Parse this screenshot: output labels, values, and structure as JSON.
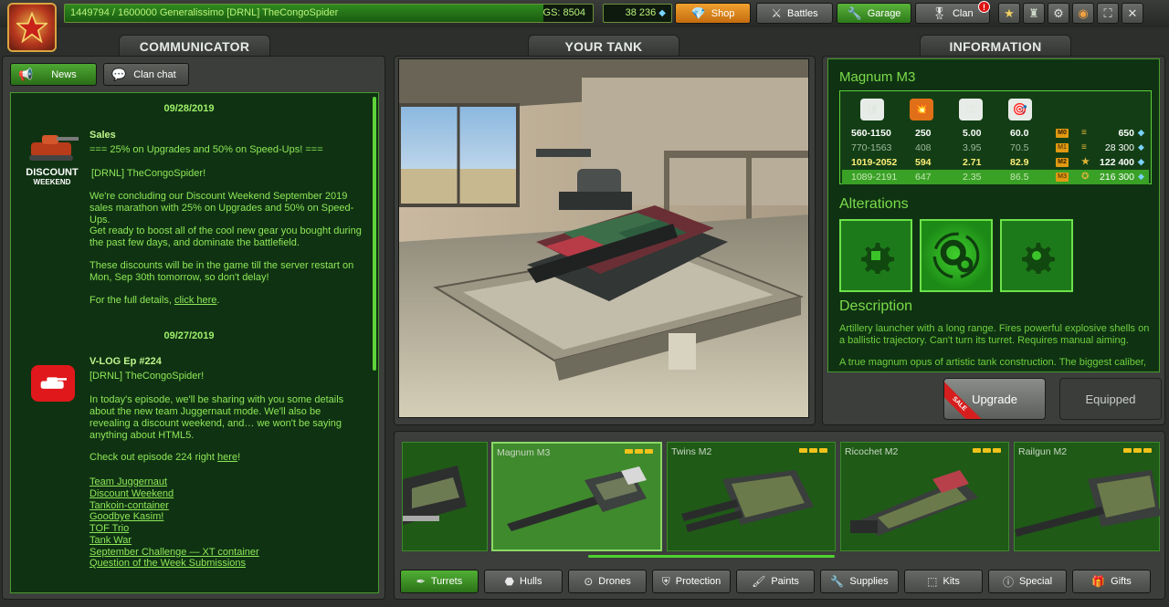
{
  "header": {
    "xp_text": "1449794 / 1600000  Generalissimo [DRNL] TheCongoSpider",
    "xp_progress": 0.906,
    "gs_text": "GS: 8504",
    "crystals": "38 236",
    "nav": [
      {
        "label": "Shop",
        "icon": "diamond-icon"
      },
      {
        "label": "Battles",
        "icon": "crossed-swords-icon"
      },
      {
        "label": "Garage",
        "icon": "wrench-icon"
      },
      {
        "label": "Clan",
        "icon": "medal-icon"
      }
    ],
    "clan_notification": "!",
    "icon_buttons": [
      "star-icon",
      "team-icon",
      "gear-icon",
      "sound-icon",
      "fullscreen-icon",
      "close-icon"
    ]
  },
  "communicator": {
    "tab_title": "COMMUNICATOR",
    "news_label": "News",
    "clanchat_label": "Clan chat",
    "posts": [
      {
        "date": "09/28/2019",
        "title": "Sales",
        "lines": [
          "=== 25% on Upgrades and 50% on Speed-Ups! ===",
          "[DRNL] TheCongoSpider!",
          "We're concluding our Discount Weekend September 2019 sales marathon with 25% on Upgrades and 50% on Speed-Ups.",
          "Get ready to boost all of the cool new gear you bought during the past few days, and dominate the battlefield.",
          "These discounts will be in the game till the server restart on Mon, Sep 30th tomorrow, so don't delay!",
          "For the full details, ",
          "click here",
          "."
        ],
        "badge_line1": "DISCOUNT",
        "badge_line2": "WEEKEND"
      },
      {
        "date": "09/27/2019",
        "title": "V-LOG Ep #224",
        "lines": [
          "[DRNL] TheCongoSpider!",
          "In today's episode, we'll be sharing with you some details about the new team Juggernaut mode. We'll also be revealing a discount weekend, and… we won't be saying anything about HTML5.",
          "Check out episode 224 right  ",
          "here",
          "!"
        ],
        "links": [
          "Team Juggernaut",
          "Discount Weekend",
          "Tankoin-container",
          "Goodbye Kasim!",
          "TOF Trio",
          "Tank War",
          "September Challenge — XT container",
          "Question of the Week Submissions"
        ]
      }
    ]
  },
  "tank": {
    "tab_title": "YOUR TANK"
  },
  "info": {
    "tab_title": "INFORMATION",
    "item_name": "Magnum M3",
    "stat_icons": [
      "damage-icon",
      "fire-icon",
      "reload-icon",
      "impact-icon"
    ],
    "rows": [
      {
        "v": [
          "560-1150",
          "250",
          "5.00",
          "60.0"
        ],
        "mk": "M0",
        "price": "650"
      },
      {
        "v": [
          "770-1563",
          "408",
          "3.95",
          "70.5"
        ],
        "mk": "M1",
        "price": "28 300"
      },
      {
        "v": [
          "1019-2052",
          "594",
          "2.71",
          "82.9"
        ],
        "mk": "M2",
        "price": "122 400"
      },
      {
        "v": [
          "1089-2191",
          "647",
          "2.35",
          "86.5"
        ],
        "mk": "M3",
        "price": "216 300"
      }
    ],
    "alterations_title": "Alterations",
    "description_title": "Description",
    "description_1": "Artillery launcher with a long range. Fires powerful explosive shells on a ballistic trajectory. Can't turn its turret. Requires manual aiming.",
    "description_2": "A true magnum opus of artistic tank construction. The biggest caliber,",
    "upgrade_label": "Upgrade",
    "sale_label": "SALE",
    "equipped_label": "Equipped"
  },
  "shelf": {
    "items": [
      {
        "name": ""
      },
      {
        "name": "Magnum M3"
      },
      {
        "name": "Twins M2"
      },
      {
        "name": "Ricochet M2"
      },
      {
        "name": "Railgun M2"
      }
    ]
  },
  "categories": [
    {
      "label": "Turrets",
      "icon": "turret-icon"
    },
    {
      "label": "Hulls",
      "icon": "hull-icon"
    },
    {
      "label": "Drones",
      "icon": "drone-icon"
    },
    {
      "label": "Protection",
      "icon": "shield-icon"
    },
    {
      "label": "Paints",
      "icon": "paint-icon"
    },
    {
      "label": "Supplies",
      "icon": "wrench-icon"
    },
    {
      "label": "Kits",
      "icon": "box-icon"
    },
    {
      "label": "Special",
      "icon": "exclamation-icon"
    },
    {
      "label": "Gifts",
      "icon": "gift-icon"
    }
  ]
}
